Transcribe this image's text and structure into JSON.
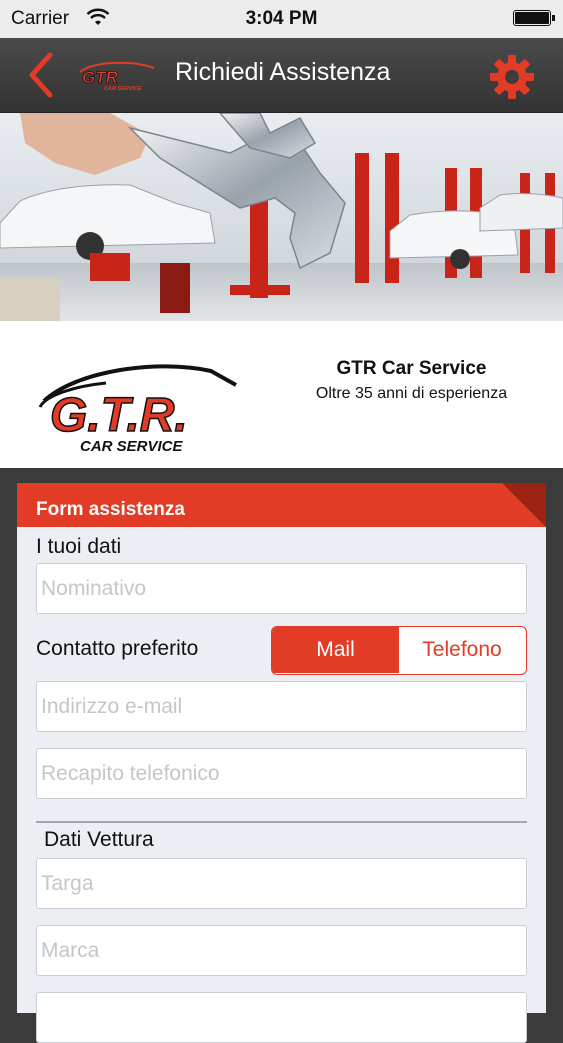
{
  "status_bar": {
    "carrier": "Carrier",
    "time": "3:04 PM"
  },
  "nav": {
    "title": "Richiedi Assistenza",
    "logo_text": "GTR",
    "logo_subtext": "CAR SERVICE",
    "back_icon": "chevron-left-icon",
    "settings_icon": "gear-icon"
  },
  "brand": {
    "logo_text": "G.T.R.",
    "logo_subtext": "CAR SERVICE",
    "name": "GTR Car Service",
    "tagline": "Oltre 35 anni di esperienza"
  },
  "form": {
    "title": "Form assistenza",
    "personal_section": "I tuoi dati",
    "name_placeholder": "Nominativo",
    "contact_label": "Contatto preferito",
    "contact_options": [
      "Mail",
      "Telefono"
    ],
    "contact_selected": "Mail",
    "email_placeholder": "Indirizzo e-mail",
    "phone_placeholder": "Recapito telefonico",
    "car_section": "Dati Vettura",
    "plate_placeholder": "Targa",
    "brand_placeholder": "Marca"
  },
  "colors": {
    "accent": "#e23b26",
    "nav_bg": "#3d3d3d",
    "page_bg": "#3b3b3b",
    "card_bg": "#ebeff3"
  }
}
